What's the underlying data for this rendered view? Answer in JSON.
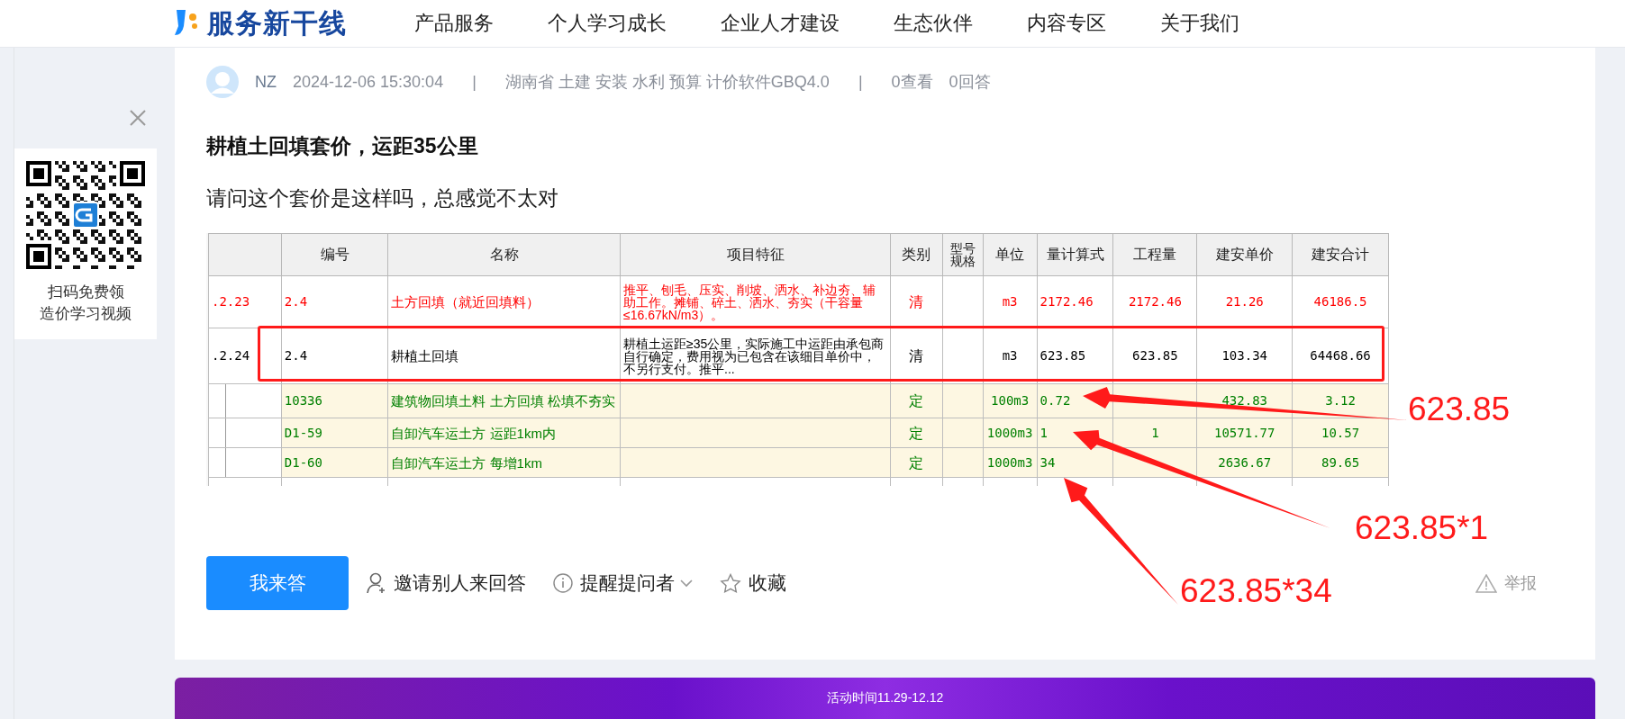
{
  "header": {
    "logo_text": "服务新干线",
    "nav": [
      {
        "label": "产品服务"
      },
      {
        "label": "个人学习成长"
      },
      {
        "label": "企业人才建设"
      },
      {
        "label": "生态伙伴"
      },
      {
        "label": "内容专区"
      },
      {
        "label": "关于我们"
      }
    ]
  },
  "qr_panel": {
    "caption_lines": [
      "扫码免费领",
      "造价学习视频"
    ]
  },
  "question": {
    "author": "NZ",
    "date": "2024-12-06 15:30:04",
    "separator_1": "|",
    "tags": "湖南省  土建 安装 水利 预算 计价软件GBQ4.0",
    "separator_2": "|",
    "views": "0查看",
    "answers": "0回答",
    "title": "耕植土回填套价，运距35公里",
    "body": "请问这个套价是这样吗，总感觉不太对",
    "table": {
      "columns": [
        "编号",
        "名称",
        "项目特征",
        "类别",
        "型号规格",
        "单位",
        "量计算式",
        "工程量",
        "建安单价",
        "建安合计"
      ],
      "rows": [
        {
          "kind": "bill",
          "color": "#ff0000",
          "highlighted": false,
          "index": ".2.23",
          "code": "2.4",
          "name": "土方回填（就近回填料）",
          "features": "推平、刨毛、压实、削坡、洒水、补边夯、辅助工作。摊铺、碎土、洒水、夯实（干容量≤16.67kN/m3）。",
          "type": "清",
          "unit": "m3",
          "formula": "2172.46",
          "quantity": "2172.46",
          "unit_price": "21.26",
          "total": "46186.5"
        },
        {
          "kind": "bill",
          "color": "#000000",
          "highlighted": true,
          "index": ".2.24",
          "code": "2.4",
          "name": "耕植土回填",
          "features": "耕植土运距≥35公里，实际施工中运距由承包商自行确定，费用视为已包含在该细目单价中，不另行支付。推平...",
          "type": "清",
          "unit": "m3",
          "formula": "623.85",
          "quantity": "623.85",
          "unit_price": "103.34",
          "total": "64468.66"
        },
        {
          "kind": "quota",
          "color": "#008000",
          "highlighted": false,
          "code": "10336",
          "name": "建筑物回填土料 土方回填 松填不夯实",
          "type": "定",
          "unit": "100m3",
          "formula": "0.72",
          "unit_price": "432.83",
          "total": "3.12"
        },
        {
          "kind": "quota",
          "color": "#008000",
          "highlighted": false,
          "code": "D1-59",
          "name": "自卸汽车运土方 运距1km内",
          "type": "定",
          "unit": "1000m3",
          "formula": "1",
          "quantity": "1",
          "unit_price": "10571.77",
          "total": "10.57"
        },
        {
          "kind": "quota",
          "color": "#008000",
          "highlighted": false,
          "code": "D1-60",
          "name": "自卸汽车运土方 每增1km",
          "type": "定",
          "unit": "1000m3",
          "formula": "34",
          "unit_price": "2636.67",
          "total": "89.65"
        }
      ]
    },
    "annotations": [
      {
        "label": "623.85"
      },
      {
        "label": "623.85*1"
      },
      {
        "label": "623.85*34"
      }
    ]
  },
  "actions": {
    "answer": "我来答",
    "invite": "邀请别人来回答",
    "remind": "提醒提问者",
    "favorite": "收藏",
    "report": "举报"
  },
  "banner": {
    "text": "活动时间11.29-12.12"
  }
}
